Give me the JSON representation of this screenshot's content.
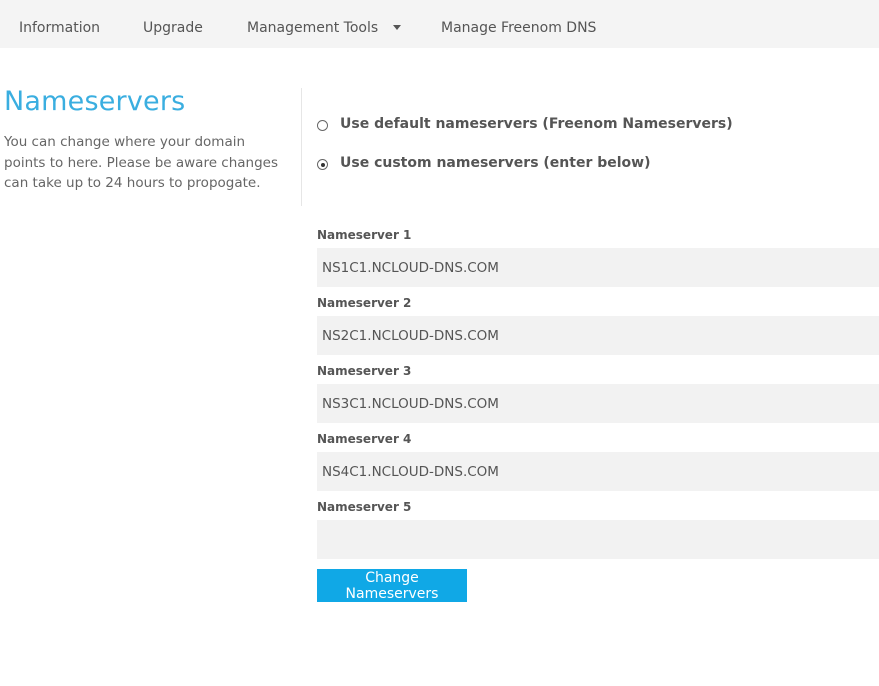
{
  "nav": {
    "items": [
      {
        "label": "Information"
      },
      {
        "label": "Upgrade"
      },
      {
        "label": "Management Tools"
      },
      {
        "label": "Manage Freenom DNS"
      }
    ]
  },
  "section": {
    "title": "Nameservers",
    "description": "You can change where your domain points to here. Please be aware changes can take up to 24 hours to propogate."
  },
  "options": {
    "default_label": "Use default nameservers (Freenom Nameservers)",
    "custom_label": "Use custom nameservers (enter below)",
    "selected": "custom"
  },
  "nameservers": [
    {
      "label": "Nameserver 1",
      "value": "NS1C1.NCLOUD-DNS.COM"
    },
    {
      "label": "Nameserver 2",
      "value": "NS2C1.NCLOUD-DNS.COM"
    },
    {
      "label": "Nameserver 3",
      "value": "NS3C1.NCLOUD-DNS.COM"
    },
    {
      "label": "Nameserver 4",
      "value": "NS4C1.NCLOUD-DNS.COM"
    },
    {
      "label": "Nameserver 5",
      "value": ""
    }
  ],
  "submit_label": "Change Nameservers",
  "colors": {
    "accent": "#3aaee0",
    "button": "#10a8e6",
    "nav_background": "#f4f4f4",
    "input_background": "#f2f2f2"
  }
}
